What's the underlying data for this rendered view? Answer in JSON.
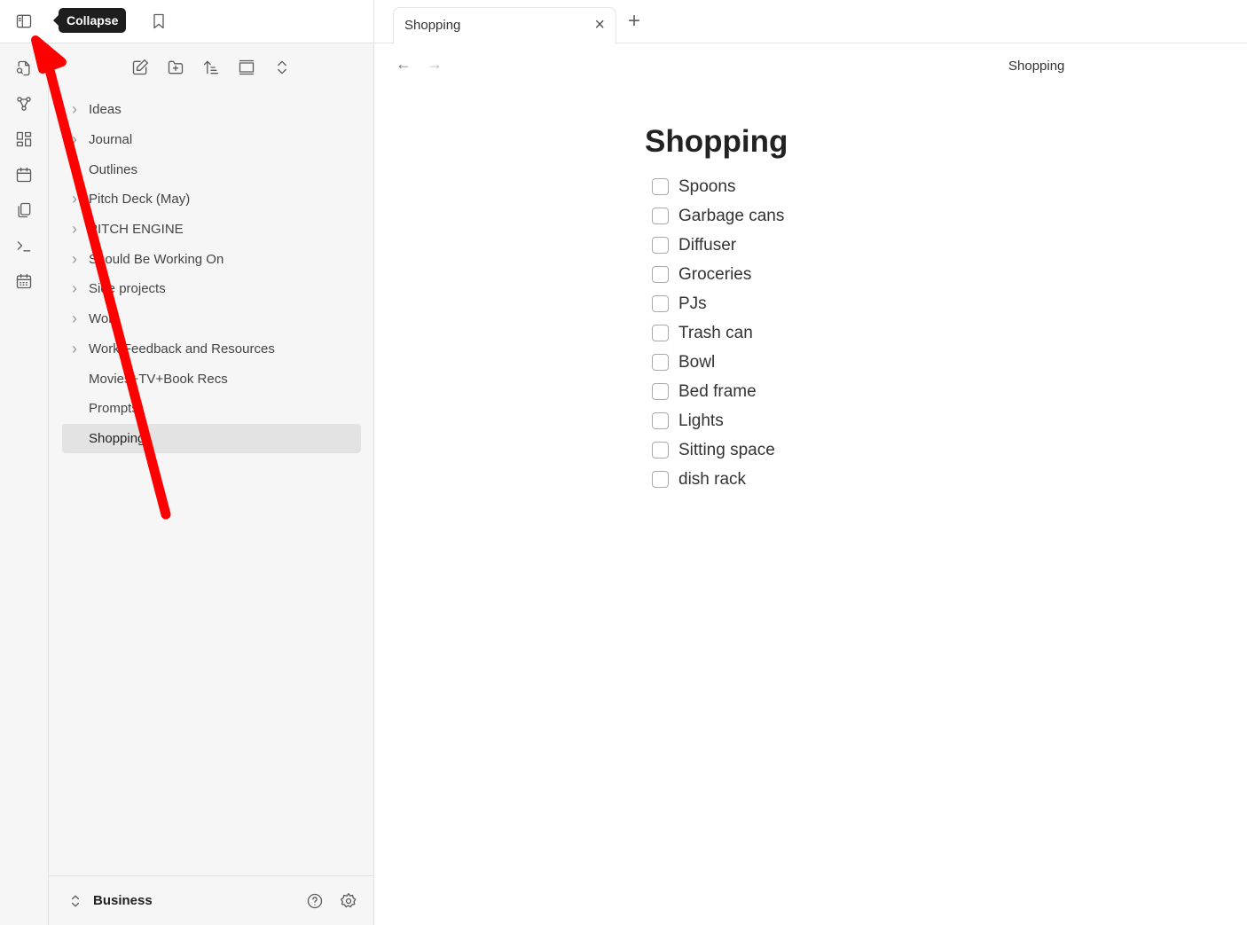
{
  "tooltip": "Collapse",
  "ribbon": {
    "icons": [
      "quick-switcher-icon",
      "graph-icon",
      "canvas-icon",
      "daily-note-icon",
      "templates-icon",
      "command-palette-icon",
      "calendar-icon"
    ]
  },
  "sidebar": {
    "toolbar": [
      "new-note",
      "new-folder",
      "sort",
      "collapse-view",
      "expand-collapse"
    ],
    "items": [
      {
        "label": "Ideas",
        "folder": true
      },
      {
        "label": "Journal",
        "folder": true
      },
      {
        "label": "Outlines",
        "folder": false
      },
      {
        "label": "Pitch Deck (May)",
        "folder": true
      },
      {
        "label": "PITCH ENGINE",
        "folder": true
      },
      {
        "label": "Should Be Working On",
        "folder": true
      },
      {
        "label": "Side projects",
        "folder": true
      },
      {
        "label": "Work",
        "folder": true
      },
      {
        "label": "Work Feedback and Resources",
        "folder": true
      },
      {
        "label": "Movies+TV+Book Recs",
        "folder": false
      },
      {
        "label": "Prompts",
        "folder": false
      },
      {
        "label": "Shopping",
        "folder": false,
        "active": true
      }
    ],
    "vault": "Business"
  },
  "tab": {
    "title": "Shopping"
  },
  "breadcrumb": "Shopping",
  "note": {
    "title": "Shopping",
    "tasks": [
      "Spoons",
      "Garbage cans",
      "Diffuser",
      "Groceries",
      "PJs",
      "Trash can",
      "Bowl",
      "Bed frame",
      "Lights",
      "Sitting space",
      "dish rack"
    ]
  },
  "annotation_color": "#ff0000"
}
